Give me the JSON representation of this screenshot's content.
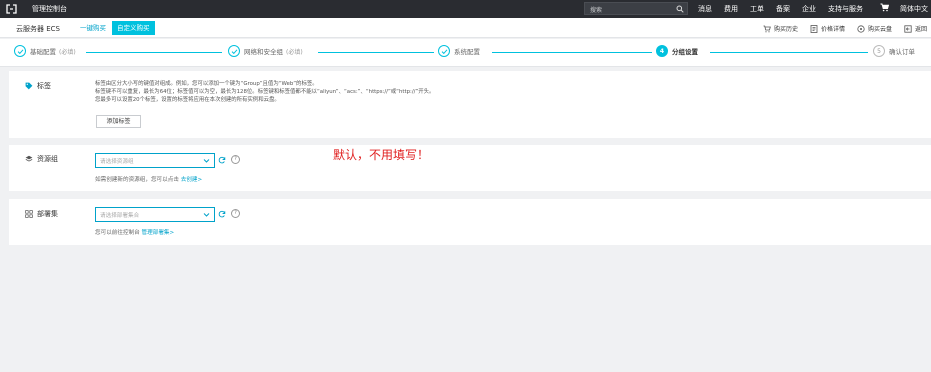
{
  "topnav": {
    "title": "管理控制台",
    "search_placeholder": "搜索",
    "links": [
      "消息",
      "费用",
      "工单",
      "备案",
      "企业",
      "支持与服务"
    ],
    "language": "简体中文"
  },
  "subheader": {
    "product": "云服务器 ECS",
    "tab_quick": "一键购买",
    "tab_custom": "自定义购买",
    "links": [
      {
        "label": "购买历史",
        "icon": "receipt-icon"
      },
      {
        "label": "价格详情",
        "icon": "price-detail-icon"
      },
      {
        "label": "购买云盘",
        "icon": "disk-icon"
      },
      {
        "label": "返回",
        "icon": "return-icon"
      }
    ]
  },
  "steps": [
    {
      "label": "基础配置",
      "req": "(必填)",
      "state": "done"
    },
    {
      "label": "网络和安全组",
      "req": "(必填)",
      "state": "done"
    },
    {
      "label": "系统配置",
      "req": "",
      "state": "done"
    },
    {
      "number": "4",
      "label": "分组设置",
      "req": "",
      "state": "active"
    },
    {
      "number": "5",
      "label": "确认订单",
      "req": "",
      "state": "todo"
    }
  ],
  "tag_section": {
    "label": "标签",
    "desc": [
      "标签由区分大小写的键值对组成。例如，您可以添加一个键为“Group”且值为“Web”的标签。",
      "标签键不可以重复，最长为64位；标签值可以为空，最长为128位。标签键和标签值都不能以“aliyun”、“acs:”、“https://”或“http://”开头。",
      "您最多可以设置20个标签，设置的标签将应用在本次创建的所有实例和云盘。"
    ],
    "add_button": "添加标签"
  },
  "resource_group": {
    "label": "资源组",
    "placeholder": "请选择资源组",
    "hint": "如需创建新的资源组，您可以点击",
    "hint_link": "去创建>"
  },
  "deployment_set": {
    "label": "部署集",
    "placeholder": "请选择部署集合",
    "hint": "您可以前往控制台",
    "hint_link": "管理部署集>"
  },
  "annotation": "默认，不用填写！",
  "colors": {
    "accent": "#00c1de",
    "nav_bg": "#2a2c31",
    "annotation": "#e02020"
  }
}
